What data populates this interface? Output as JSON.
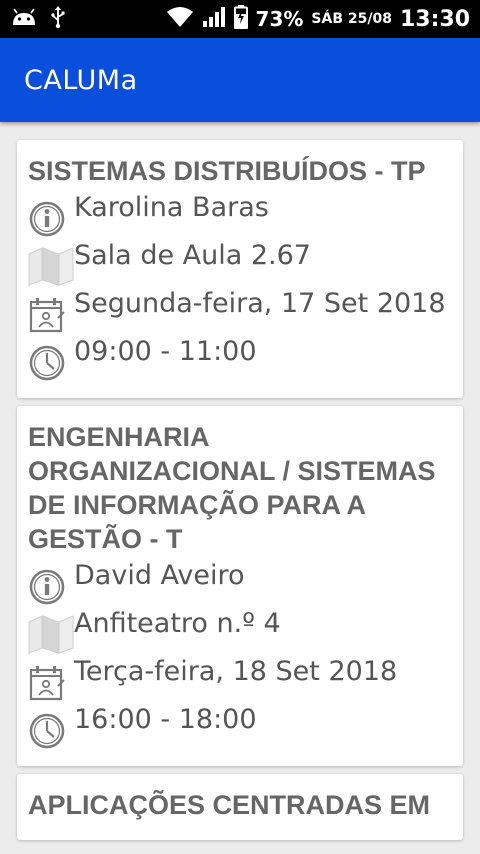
{
  "status_bar": {
    "battery": "73%",
    "date": "SÁB 25/08",
    "time": "13:30",
    "icons": [
      "android-icon",
      "usb-icon",
      "wifi-icon",
      "signal-icon",
      "battery-charging-icon"
    ]
  },
  "app_bar": {
    "title": "CALUMa",
    "color": "#0a4fdc"
  },
  "cards": [
    {
      "title": "SISTEMAS DISTRIBUÍDOS - TP",
      "teacher": "Karolina Baras",
      "room": "Sala de Aula 2.67",
      "date": "Segunda-feira, 17 Set 2018",
      "time": "09:00 - 11:00"
    },
    {
      "title": "ENGENHARIA ORGANIZACIONAL / SISTEMAS DE INFORMAÇÃO PARA A GESTÃO - T",
      "teacher": "David Aveiro",
      "room": "Anfiteatro n.º 4",
      "date": "Terça-feira, 18 Set 2018",
      "time": "16:00 - 18:00"
    },
    {
      "title": "APLICAÇÕES CENTRADAS EM"
    }
  ]
}
